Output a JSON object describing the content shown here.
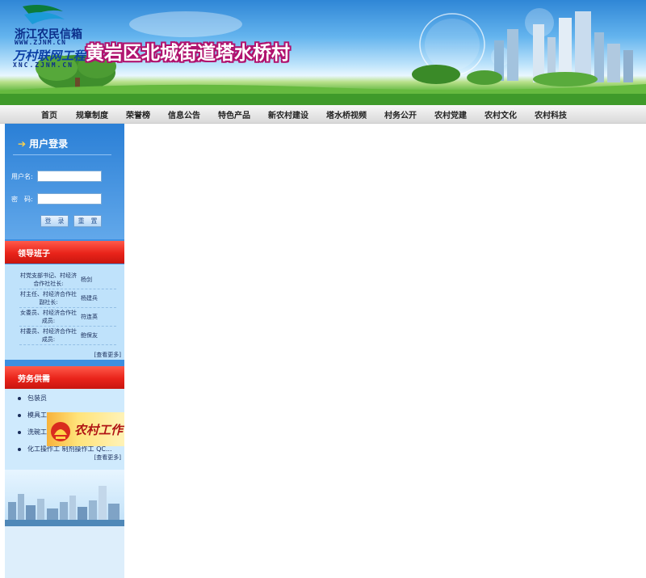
{
  "header": {
    "logo_line1": "浙江农民信箱",
    "logo_url1": "WWW.ZJNM.CN",
    "logo_line2": "万村联网工程",
    "logo_url2": "XNC.ZJNM.CN",
    "site_title": "黄岩区北城街道塔水桥村"
  },
  "nav": {
    "items": [
      "首页",
      "规章制度",
      "荣誉榜",
      "信息公告",
      "特色产品",
      "新农村建设",
      "塔水桥视频",
      "村务公开",
      "农村党建",
      "农村文化",
      "农村科技"
    ]
  },
  "login": {
    "title": "用户登录",
    "username_label": "用户名:",
    "password_label": "密　码:",
    "username_value": "",
    "password_value": "",
    "login_button": "登　录",
    "reset_button": "重　置"
  },
  "leaders": {
    "title": "领导班子",
    "rows": [
      {
        "role": "村党支部书记、村经济合作社社长:",
        "name": "杨剑"
      },
      {
        "role": "村主任、村经济合作社副社长:",
        "name": "杨建兵"
      },
      {
        "role": "女委员、村经济合作社成员:",
        "name": "符连英"
      },
      {
        "role": "村委员、村经济合作社成员:",
        "name": "鲍保友"
      }
    ],
    "more": "[查看更多]"
  },
  "supply": {
    "title": "劳务供需",
    "items": [
      "包装员",
      "模具工",
      "洗碗工",
      "化工操作工 制剂操作工 QC..."
    ],
    "more": "[查看更多]"
  },
  "ad": {
    "text": "农村工作"
  },
  "colors": {
    "nav_bg": "#e0e0e0",
    "sidebar_bg": "#3d8fe0",
    "section_header": "#e9231a",
    "title_outline": "#b0126e"
  }
}
